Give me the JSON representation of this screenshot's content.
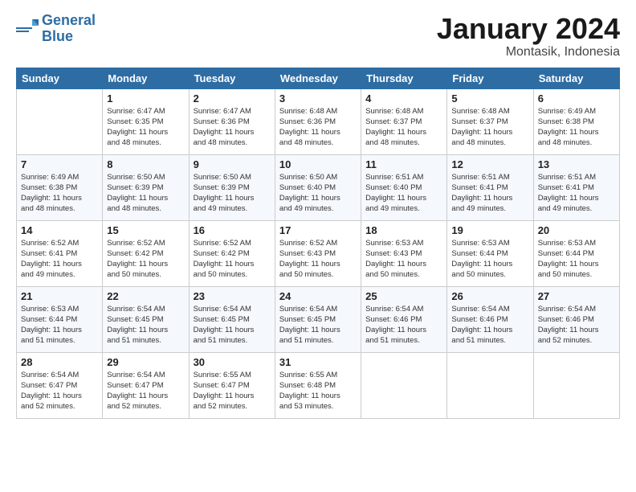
{
  "header": {
    "logo_line1": "General",
    "logo_line2": "Blue",
    "month": "January 2024",
    "location": "Montasik, Indonesia"
  },
  "days_of_week": [
    "Sunday",
    "Monday",
    "Tuesday",
    "Wednesday",
    "Thursday",
    "Friday",
    "Saturday"
  ],
  "weeks": [
    [
      {
        "day": "",
        "empty": true
      },
      {
        "day": "1",
        "sunrise": "6:47 AM",
        "sunset": "6:35 PM",
        "daylight": "11 hours and 48 minutes."
      },
      {
        "day": "2",
        "sunrise": "6:47 AM",
        "sunset": "6:36 PM",
        "daylight": "11 hours and 48 minutes."
      },
      {
        "day": "3",
        "sunrise": "6:48 AM",
        "sunset": "6:36 PM",
        "daylight": "11 hours and 48 minutes."
      },
      {
        "day": "4",
        "sunrise": "6:48 AM",
        "sunset": "6:37 PM",
        "daylight": "11 hours and 48 minutes."
      },
      {
        "day": "5",
        "sunrise": "6:48 AM",
        "sunset": "6:37 PM",
        "daylight": "11 hours and 48 minutes."
      },
      {
        "day": "6",
        "sunrise": "6:49 AM",
        "sunset": "6:38 PM",
        "daylight": "11 hours and 48 minutes."
      }
    ],
    [
      {
        "day": "7",
        "sunrise": "6:49 AM",
        "sunset": "6:38 PM",
        "daylight": "11 hours and 48 minutes."
      },
      {
        "day": "8",
        "sunrise": "6:50 AM",
        "sunset": "6:39 PM",
        "daylight": "11 hours and 48 minutes."
      },
      {
        "day": "9",
        "sunrise": "6:50 AM",
        "sunset": "6:39 PM",
        "daylight": "11 hours and 49 minutes."
      },
      {
        "day": "10",
        "sunrise": "6:50 AM",
        "sunset": "6:40 PM",
        "daylight": "11 hours and 49 minutes."
      },
      {
        "day": "11",
        "sunrise": "6:51 AM",
        "sunset": "6:40 PM",
        "daylight": "11 hours and 49 minutes."
      },
      {
        "day": "12",
        "sunrise": "6:51 AM",
        "sunset": "6:41 PM",
        "daylight": "11 hours and 49 minutes."
      },
      {
        "day": "13",
        "sunrise": "6:51 AM",
        "sunset": "6:41 PM",
        "daylight": "11 hours and 49 minutes."
      }
    ],
    [
      {
        "day": "14",
        "sunrise": "6:52 AM",
        "sunset": "6:41 PM",
        "daylight": "11 hours and 49 minutes."
      },
      {
        "day": "15",
        "sunrise": "6:52 AM",
        "sunset": "6:42 PM",
        "daylight": "11 hours and 50 minutes."
      },
      {
        "day": "16",
        "sunrise": "6:52 AM",
        "sunset": "6:42 PM",
        "daylight": "11 hours and 50 minutes."
      },
      {
        "day": "17",
        "sunrise": "6:52 AM",
        "sunset": "6:43 PM",
        "daylight": "11 hours and 50 minutes."
      },
      {
        "day": "18",
        "sunrise": "6:53 AM",
        "sunset": "6:43 PM",
        "daylight": "11 hours and 50 minutes."
      },
      {
        "day": "19",
        "sunrise": "6:53 AM",
        "sunset": "6:44 PM",
        "daylight": "11 hours and 50 minutes."
      },
      {
        "day": "20",
        "sunrise": "6:53 AM",
        "sunset": "6:44 PM",
        "daylight": "11 hours and 50 minutes."
      }
    ],
    [
      {
        "day": "21",
        "sunrise": "6:53 AM",
        "sunset": "6:44 PM",
        "daylight": "11 hours and 51 minutes."
      },
      {
        "day": "22",
        "sunrise": "6:54 AM",
        "sunset": "6:45 PM",
        "daylight": "11 hours and 51 minutes."
      },
      {
        "day": "23",
        "sunrise": "6:54 AM",
        "sunset": "6:45 PM",
        "daylight": "11 hours and 51 minutes."
      },
      {
        "day": "24",
        "sunrise": "6:54 AM",
        "sunset": "6:45 PM",
        "daylight": "11 hours and 51 minutes."
      },
      {
        "day": "25",
        "sunrise": "6:54 AM",
        "sunset": "6:46 PM",
        "daylight": "11 hours and 51 minutes."
      },
      {
        "day": "26",
        "sunrise": "6:54 AM",
        "sunset": "6:46 PM",
        "daylight": "11 hours and 51 minutes."
      },
      {
        "day": "27",
        "sunrise": "6:54 AM",
        "sunset": "6:46 PM",
        "daylight": "11 hours and 52 minutes."
      }
    ],
    [
      {
        "day": "28",
        "sunrise": "6:54 AM",
        "sunset": "6:47 PM",
        "daylight": "11 hours and 52 minutes."
      },
      {
        "day": "29",
        "sunrise": "6:54 AM",
        "sunset": "6:47 PM",
        "daylight": "11 hours and 52 minutes."
      },
      {
        "day": "30",
        "sunrise": "6:55 AM",
        "sunset": "6:47 PM",
        "daylight": "11 hours and 52 minutes."
      },
      {
        "day": "31",
        "sunrise": "6:55 AM",
        "sunset": "6:48 PM",
        "daylight": "11 hours and 53 minutes."
      },
      {
        "day": "",
        "empty": true
      },
      {
        "day": "",
        "empty": true
      },
      {
        "day": "",
        "empty": true
      }
    ]
  ]
}
